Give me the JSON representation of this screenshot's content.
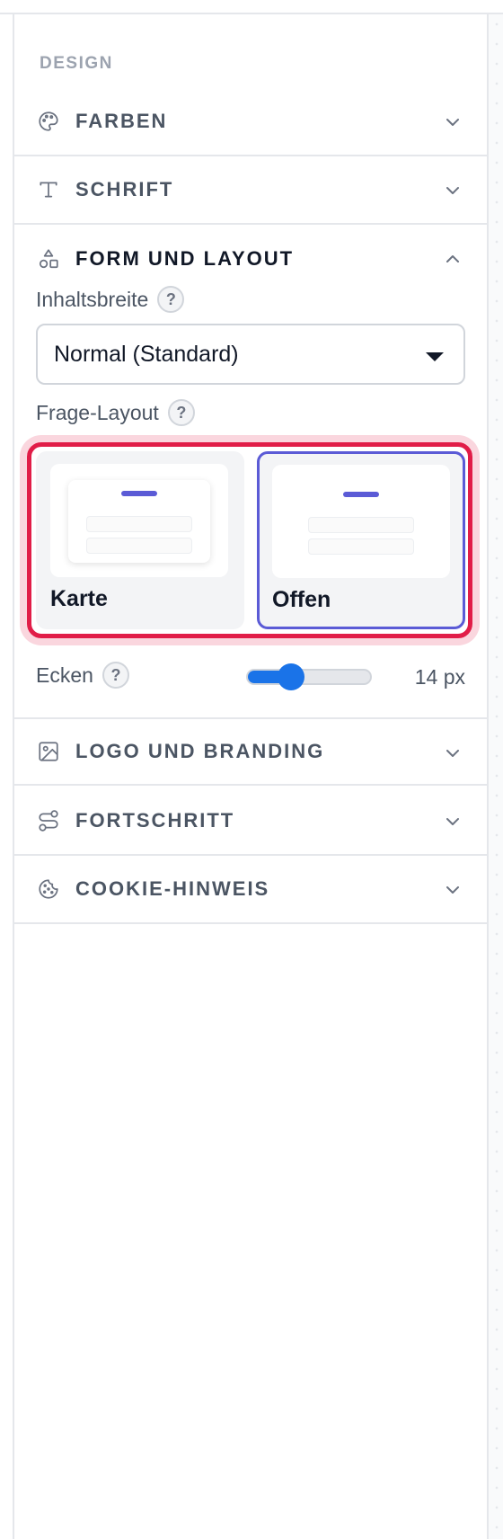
{
  "panel": {
    "heading": "DESIGN"
  },
  "sections": [
    {
      "id": "farben",
      "title": "FARBEN",
      "icon": "palette-icon",
      "expanded": false
    },
    {
      "id": "schrift",
      "title": "SCHRIFT",
      "icon": "type-icon",
      "expanded": false
    },
    {
      "id": "form",
      "title": "FORM UND LAYOUT",
      "icon": "shapes-icon",
      "expanded": true
    },
    {
      "id": "logo",
      "title": "LOGO UND BRANDING",
      "icon": "image-icon",
      "expanded": false
    },
    {
      "id": "fortschritt",
      "title": "FORTSCHRITT",
      "icon": "route-icon",
      "expanded": false
    },
    {
      "id": "cookie",
      "title": "COOKIE-HINWEIS",
      "icon": "cookie-icon",
      "expanded": false
    }
  ],
  "form_layout": {
    "content_width_label": "Inhaltsbreite",
    "content_width_value": "Normal (Standard)",
    "question_layout_label": "Frage-Layout",
    "options": [
      {
        "id": "karte",
        "label": "Karte",
        "selected": false
      },
      {
        "id": "offen",
        "label": "Offen",
        "selected": true
      }
    ],
    "corners_label": "Ecken",
    "corners_value": "14 px",
    "corners_fraction": 0.36,
    "help_glyph": "?"
  },
  "colors": {
    "accent": "#5b5bd6",
    "slider": "#1a73e8",
    "highlight": "#e11d48"
  }
}
